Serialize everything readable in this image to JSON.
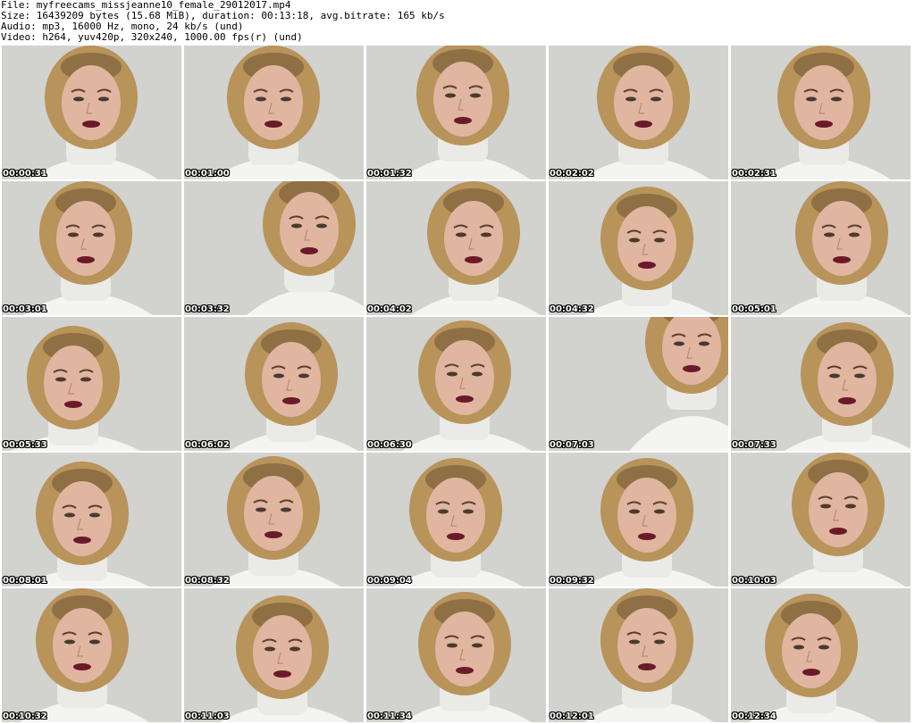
{
  "header": {
    "file": "File: myfreecams_missjeanne10_female_29012017.mp4",
    "size": "Size: 16439209 bytes (15.68 MiB), duration: 00:13:18, avg.bitrate: 165 kb/s",
    "audio": "Audio: mp3, 16000 Hz, mono, 24 kb/s (und)",
    "video": "Video: h264, yuv420p, 320x240, 1000.00 fps(r) (und)"
  },
  "thumbnails": [
    {
      "time": "00:00:31"
    },
    {
      "time": "00:01:00"
    },
    {
      "time": "00:01:32"
    },
    {
      "time": "00:02:02"
    },
    {
      "time": "00:02:31"
    },
    {
      "time": "00:03:01"
    },
    {
      "time": "00:03:32"
    },
    {
      "time": "00:04:02"
    },
    {
      "time": "00:04:32"
    },
    {
      "time": "00:05:01"
    },
    {
      "time": "00:05:33"
    },
    {
      "time": "00:06:02"
    },
    {
      "time": "00:06:30"
    },
    {
      "time": "00:07:03"
    },
    {
      "time": "00:07:33"
    },
    {
      "time": "00:08:01"
    },
    {
      "time": "00:08:32"
    },
    {
      "time": "00:09:04"
    },
    {
      "time": "00:09:32"
    },
    {
      "time": "00:10:03"
    },
    {
      "time": "00:10:32"
    },
    {
      "time": "00:11:03"
    },
    {
      "time": "00:11:34"
    },
    {
      "time": "00:12:01"
    },
    {
      "time": "00:12:34"
    }
  ],
  "colors": {
    "background": "#d2d2cf",
    "hair": "#b8935a",
    "hair_dark": "#6e5233",
    "skin": "#e0b6a0",
    "sweater": "#f4f4f2",
    "lips": "#6a1a2a"
  }
}
